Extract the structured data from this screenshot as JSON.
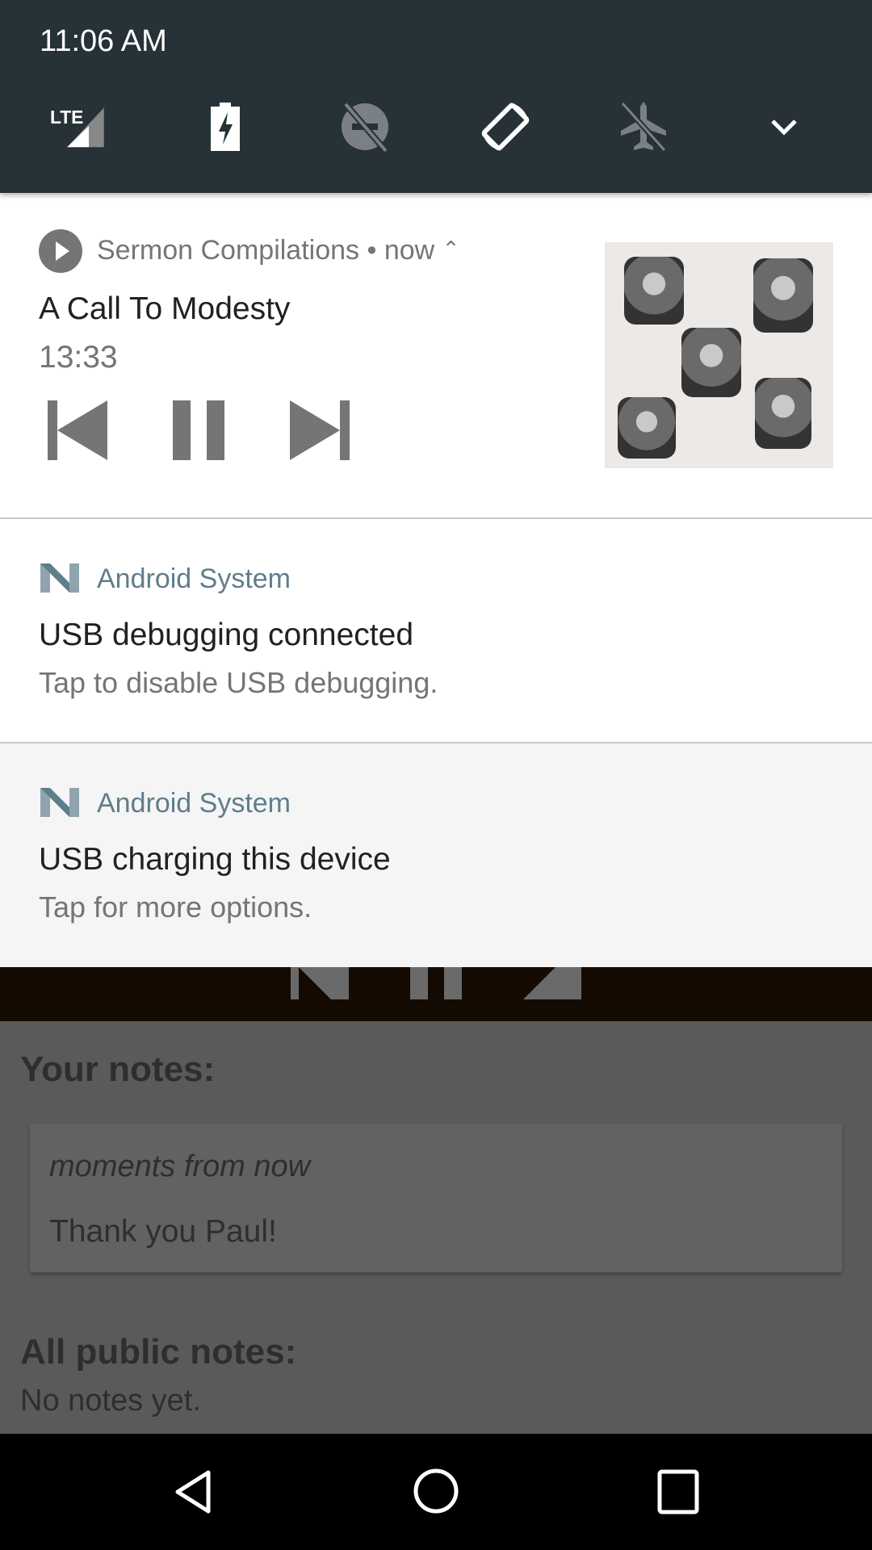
{
  "status_bar": {
    "time": "11:06 AM"
  },
  "quick_settings": [
    {
      "name": "lte-signal-icon",
      "label": "LTE",
      "active": true
    },
    {
      "name": "battery-charging-icon",
      "active": true
    },
    {
      "name": "do-not-disturb-off-icon",
      "active": false
    },
    {
      "name": "auto-rotate-icon",
      "active": true
    },
    {
      "name": "airplane-mode-off-icon",
      "active": false
    },
    {
      "name": "expand-chevron-icon",
      "active": true
    }
  ],
  "media_notification": {
    "app": "Sermon Compilations",
    "separator": "•",
    "time": "now",
    "title": "A Call To Modesty",
    "duration": "13:33"
  },
  "notifications": [
    {
      "app": "Android System",
      "title": "USB debugging connected",
      "text": "Tap to disable USB debugging."
    },
    {
      "app": "Android System",
      "title": "USB charging this device",
      "text": "Tap for more options."
    }
  ],
  "background_app": {
    "your_notes_heading": "Your notes:",
    "note_time": "moments from now",
    "note_text": "Thank you Paul!",
    "public_heading": "All public notes:",
    "public_empty": "No notes yet."
  },
  "colors": {
    "header": "#263238",
    "system_app": "#607d8b",
    "dim": "#5a5a58"
  }
}
